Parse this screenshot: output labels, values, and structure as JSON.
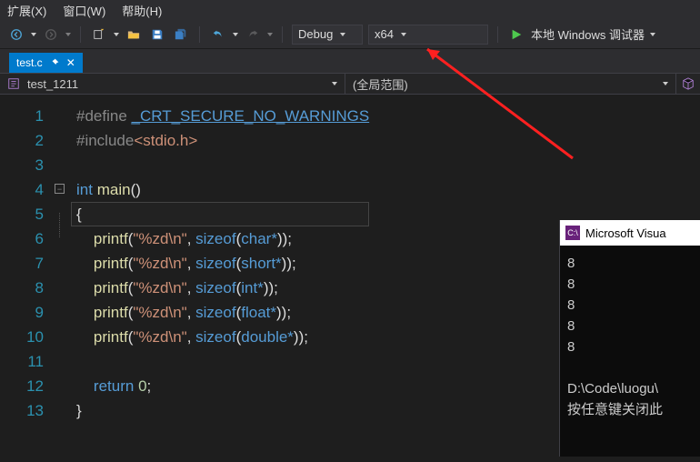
{
  "menu": {
    "ext": "扩展(X)",
    "win": "窗口(W)",
    "help": "帮助(H)"
  },
  "toolbar": {
    "config": "Debug",
    "platform": "x64",
    "debugger": "本地 Windows 调试器"
  },
  "tab": {
    "name": "test.c"
  },
  "nav": {
    "project": "test_1211",
    "scope": "(全局范围)"
  },
  "lines": [
    "1",
    "2",
    "3",
    "4",
    "5",
    "6",
    "7",
    "8",
    "9",
    "10",
    "11",
    "12",
    "13"
  ],
  "code": {
    "define_pre": "#define ",
    "define_sym": "_CRT_SECURE_NO_WARNINGS",
    "include": "#include",
    "include_arg": "<stdio.h>",
    "int": "int",
    "main": "main",
    "paren": "()",
    "lb": "{",
    "rb": "}",
    "printf": "printf",
    "sizeof": "sizeof",
    "fmt": "\"%zd\\n\"",
    "args": [
      "char*",
      "short*",
      "int*",
      "float*",
      "double*"
    ],
    "ret": "return",
    "zero": "0"
  },
  "console": {
    "title": "Microsoft Visua",
    "out": [
      "8",
      "8",
      "8",
      "8",
      "8",
      "",
      "D:\\Code\\luogu\\",
      "按任意键关闭此"
    ]
  }
}
